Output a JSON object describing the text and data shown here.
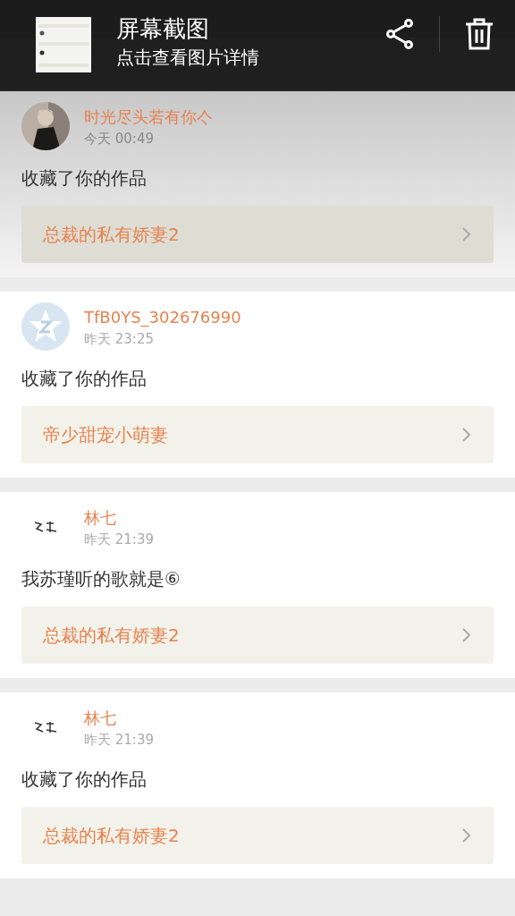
{
  "notification": {
    "title": "屏幕截图",
    "subtitle": "点击查看图片详情"
  },
  "messages": [
    {
      "name": "时光尽头若有你亽",
      "time": "今天 00:49",
      "text": "收藏了你的作品",
      "work": "总裁的私有娇妻2",
      "dimmed": true
    },
    {
      "avatar": {
        "kind": "star"
      },
      "name": "TfB0YS_302676990",
      "time": "昨天 23:25",
      "text": "收藏了你的作品",
      "work": "帝少甜宠小萌妻",
      "dimmed": false
    },
    {
      "avatar": {
        "kind": "calligraphy"
      },
      "name": "林七",
      "time": "昨天 21:39",
      "text": "我苏瑾听的歌就是⑥",
      "work": "总裁的私有娇妻2",
      "dimmed": false
    },
    {
      "avatar": {
        "kind": "calligraphy"
      },
      "name": "林七",
      "time": "昨天 21:39",
      "text": "收藏了你的作品",
      "work": "总裁的私有娇妻2",
      "dimmed": false
    }
  ]
}
